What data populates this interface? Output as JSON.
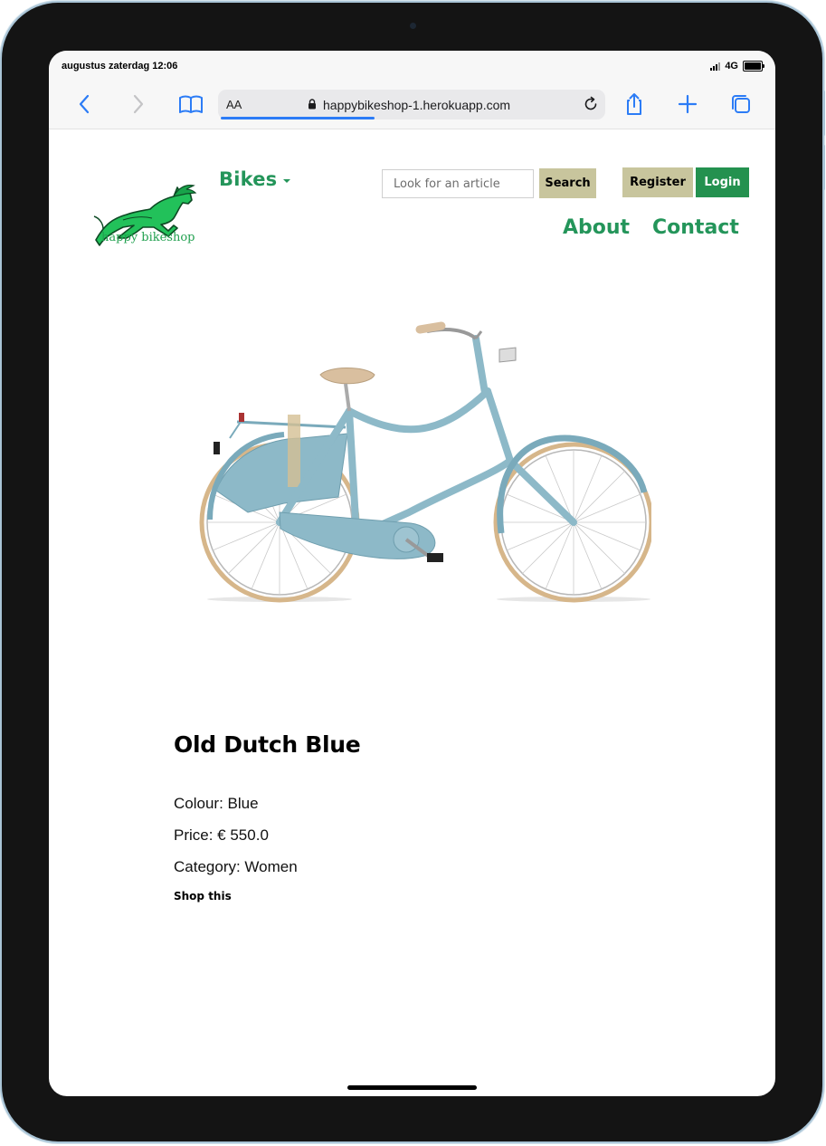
{
  "status_bar": {
    "time": "augustus zaterdag 12:06",
    "network": "4G"
  },
  "browser": {
    "text_size_label": "AA",
    "url": "happybikeshop-1.herokuapp.com"
  },
  "site": {
    "logo_text": "happy bikeshop",
    "bikes_menu_label": "Bikes",
    "search": {
      "placeholder": "Look for an article",
      "button_label": "Search"
    },
    "auth": {
      "register_label": "Register",
      "login_label": "Login"
    },
    "nav": {
      "about_label": "About",
      "contact_label": "Contact"
    }
  },
  "product": {
    "title": "Old Dutch Blue",
    "colour_line": "Colour: Blue",
    "price_line": "Price: € 550.0",
    "category_line": "Category: Women",
    "shop_link_label": "Shop this"
  },
  "colors": {
    "brand_green": "#24955a",
    "button_beige": "#c8c59d",
    "login_green": "#24914f",
    "bike_blue": "#8db9c8"
  }
}
